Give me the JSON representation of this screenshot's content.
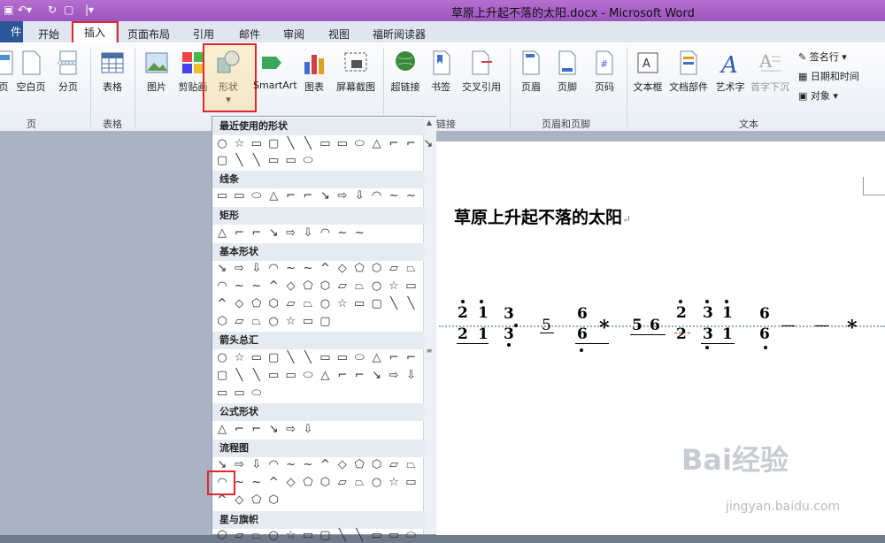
{
  "window": {
    "title": "草原上升起不落的太阳.docx - Microsoft Word"
  },
  "tabs": [
    {
      "label": "件"
    },
    {
      "label": "开始"
    },
    {
      "label": "插入"
    },
    {
      "label": "页面布局"
    },
    {
      "label": "引用"
    },
    {
      "label": "邮件"
    },
    {
      "label": "审阅"
    },
    {
      "label": "视图"
    },
    {
      "label": "福昕阅读器"
    }
  ],
  "ribbon": {
    "buttons": [
      {
        "label": "页"
      },
      {
        "label": "空白页"
      },
      {
        "label": "分页"
      },
      {
        "label": "表格"
      },
      {
        "label": "图片"
      },
      {
        "label": "剪贴画"
      },
      {
        "label": "形状"
      },
      {
        "label": "SmartArt"
      },
      {
        "label": "图表"
      },
      {
        "label": "屏幕截图"
      },
      {
        "label": "超链接"
      },
      {
        "label": "书签"
      },
      {
        "label": "交叉引用"
      },
      {
        "label": "页眉"
      },
      {
        "label": "页脚"
      },
      {
        "label": "页码"
      },
      {
        "label": "文本框"
      },
      {
        "label": "文档部件"
      },
      {
        "label": "艺术字"
      },
      {
        "label": "首字下沉"
      }
    ],
    "small_buttons": [
      {
        "label": "签名行"
      },
      {
        "label": "日期和时间"
      },
      {
        "label": "对象"
      }
    ],
    "groups": [
      {
        "label": "页"
      },
      {
        "label": "表格"
      },
      {
        "label": "链接"
      },
      {
        "label": "页眉和页脚"
      },
      {
        "label": "文本"
      }
    ]
  },
  "gallery": {
    "categories": [
      {
        "label": "最近使用的形状"
      },
      {
        "label": "线条"
      },
      {
        "label": "矩形"
      },
      {
        "label": "基本形状"
      },
      {
        "label": "箭头总汇"
      },
      {
        "label": "公式形状"
      },
      {
        "label": "流程图"
      },
      {
        "label": "星与旗帜"
      }
    ]
  },
  "document": {
    "title": "草原上升起不落的太阳",
    "score_text": [
      "2",
      "1",
      "3",
      "5",
      "6",
      "*",
      "5",
      "6",
      "2",
      "3",
      "1",
      "6",
      "—",
      "—",
      "*"
    ]
  },
  "watermark": {
    "brand": "Bai经验",
    "url": "jingyan.baidu.com"
  },
  "colors": {
    "title_bar": "#9b55bd",
    "highlight_red": "#e0282e",
    "file_tab": "#2b579a"
  }
}
